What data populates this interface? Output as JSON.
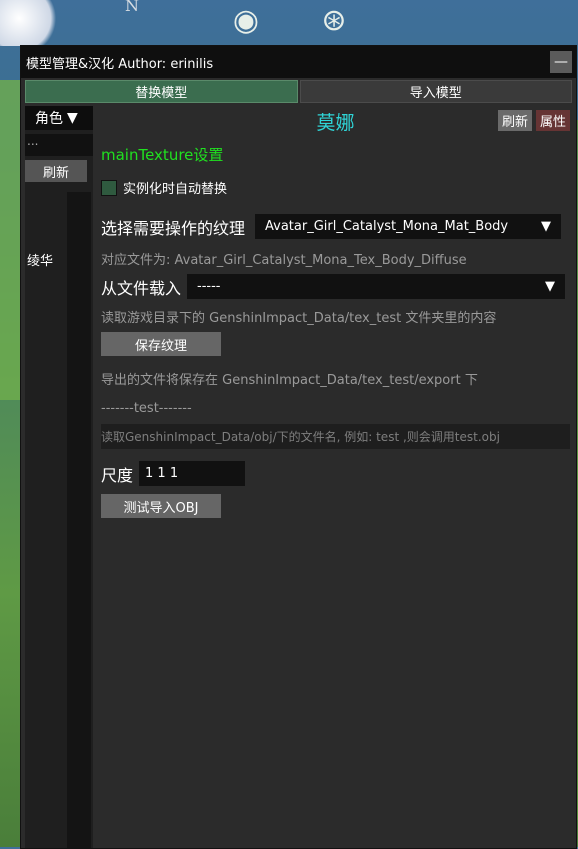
{
  "hud": {
    "compass": "N"
  },
  "window": {
    "title": "模型管理&汉化 Author: erinilis",
    "minimize": "—",
    "tabs": [
      {
        "label": "替换模型",
        "active": true
      },
      {
        "label": "导入模型",
        "active": false
      }
    ]
  },
  "left": {
    "role_select": "角色",
    "role_arrow": "▼",
    "search_value": "...",
    "refresh": "刷新",
    "items": [
      "绫华"
    ]
  },
  "main": {
    "character_name": "莫娜",
    "refresh": "刷新",
    "attributes": "属性",
    "section_title": "mainTexture设置",
    "auto_replace_label": "实例化时自动替换",
    "texture_label": "选择需要操作的纹理",
    "texture_value": "Avatar_Girl_Catalyst_Mona_Mat_Body",
    "dropdown_arrow": "▼",
    "mapped_file": "对应文件为: Avatar_Girl_Catalyst_Mona_Tex_Body_Diffuse",
    "load_from_file_label": "从文件载入",
    "load_from_file_value": "-----",
    "load_hint": "读取游戏目录下的 GenshinImpact_Data/tex_test 文件夹里的内容",
    "save_texture": "保存纹理",
    "save_hint": "导出的文件将保存在 GenshinImpact_Data/tex_test/export 下",
    "test_separator": "-------test-------",
    "obj_hint": "读取GenshinImpact_Data/obj/下的文件名, 例如: test ,则会调用test.obj",
    "scale_label": "尺度",
    "scale_value": "1 1 1",
    "test_import": "测试导入OBJ"
  },
  "colors": {
    "accent_name": "#2fd4d6",
    "section_green": "#20e020",
    "active_tab": "#3b6d4f",
    "attr_button": "#663434"
  }
}
